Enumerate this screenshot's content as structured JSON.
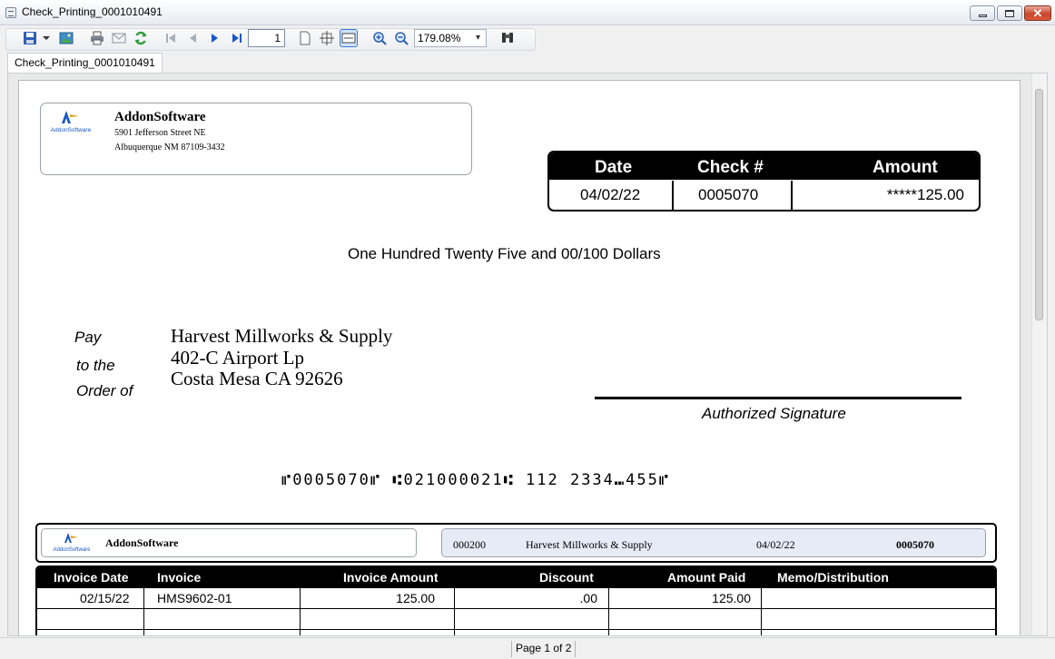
{
  "window": {
    "title": "Check_Printing_0001010491"
  },
  "toolbar": {
    "page_value": "1",
    "zoom": "179.08%",
    "icons": [
      "save-icon",
      "dropdown-icon",
      "export-image-icon",
      "print-icon",
      "email-icon",
      "refresh-icon",
      "first-page-icon",
      "prev-page-icon",
      "next-page-icon",
      "last-page-icon",
      "single-page-icon",
      "fit-page-icon",
      "page-width-icon",
      "zoom-in-icon",
      "zoom-out-icon",
      "find-icon"
    ]
  },
  "tab": {
    "label": "Check_Printing_0001010491"
  },
  "check": {
    "company": {
      "logo_text": "AddonSoftware",
      "name": "AddonSoftware",
      "street": "5901 Jefferson Street NE",
      "city": "Albuquerque NM  87109-3432"
    },
    "headers": {
      "date": "Date",
      "check_no": "Check #",
      "amount": "Amount"
    },
    "values": {
      "date": "04/02/22",
      "check_no": "0005070",
      "amount": "*****125.00"
    },
    "amount_words": "One Hundred Twenty Five and 00/100 Dollars",
    "pay_labels": {
      "pay": "Pay",
      "to_the": "to the",
      "order_of": "Order of"
    },
    "payee": {
      "name": "Harvest Millworks & Supply",
      "street": "402-C Airport Lp",
      "city": "Costa Mesa CA  92626"
    },
    "signature_label": "Authorized Signature",
    "micr": "⑈0005070⑈  ⑆021000021⑆  112  2334⑉455⑈"
  },
  "stub": {
    "company_name": "AddonSoftware",
    "logo_text": "AddonSoftware",
    "vendor_code": "000200",
    "vendor_name": "Harvest Millworks & Supply",
    "date": "04/02/22",
    "check_no": "0005070"
  },
  "invoice_table": {
    "columns": [
      "Invoice Date",
      "Invoice",
      "Invoice Amount",
      "Discount",
      "Amount Paid",
      "Memo/Distribution"
    ],
    "rows": [
      {
        "invoice_date": "02/15/22",
        "invoice": "HMS9602-01",
        "invoice_amount": "125.00",
        "discount": ".00",
        "amount_paid": "125.00",
        "memo": ""
      }
    ]
  },
  "status": {
    "page": "Page 1 of 2"
  },
  "colors": {
    "accent_blue": "#1a57c6",
    "stub_fill": "#e7ebf6",
    "close_button": "#c9462c"
  }
}
